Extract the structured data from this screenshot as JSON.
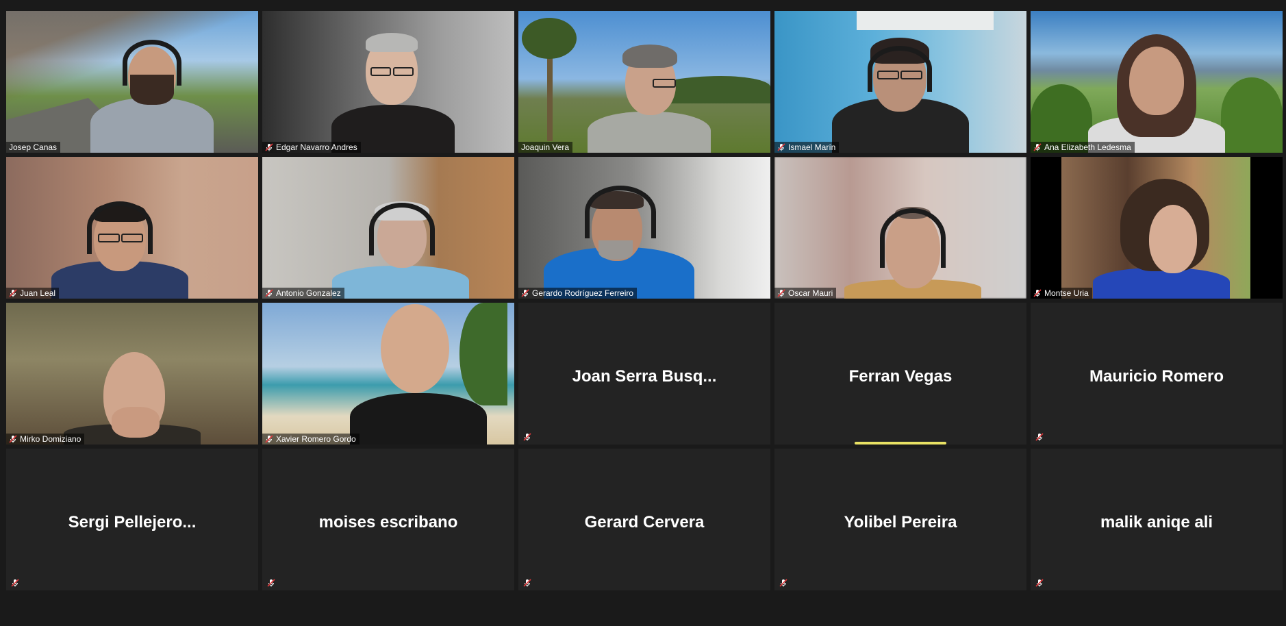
{
  "meeting": {
    "participants": [
      {
        "name": "Josep Canas",
        "video": true,
        "muted": false
      },
      {
        "name": "Edgar Navarro Andres",
        "video": true,
        "muted": true
      },
      {
        "name": "Joaquin Vera",
        "video": true,
        "muted": false,
        "active_speaker": true
      },
      {
        "name": "Ismael Marín",
        "video": true,
        "muted": true
      },
      {
        "name": "Ana Elizabeth Ledesma",
        "video": true,
        "muted": true
      },
      {
        "name": "Juan Leal",
        "video": true,
        "muted": true
      },
      {
        "name": "Antonio Gonzalez",
        "video": true,
        "muted": true
      },
      {
        "name": "Gerardo Rodríguez Ferreiro",
        "video": true,
        "muted": true
      },
      {
        "name": "Oscar Mauri",
        "video": true,
        "muted": true
      },
      {
        "name": "Montse Uria",
        "video": true,
        "muted": true
      },
      {
        "name": "Mirko Domiziano",
        "video": true,
        "muted": true
      },
      {
        "name": "Xavier Romero Gordo",
        "video": true,
        "muted": true
      },
      {
        "name": "Joan  Serra  Busq...",
        "video": false,
        "muted": true
      },
      {
        "name": "Ferran Vegas",
        "video": false,
        "muted": false,
        "speaking": true
      },
      {
        "name": "Mauricio Romero",
        "video": false,
        "muted": true
      },
      {
        "name": "Sergi  Pellejero...",
        "video": false,
        "muted": true
      },
      {
        "name": "moises escribano",
        "video": false,
        "muted": true
      },
      {
        "name": "Gerard Cervera",
        "video": false,
        "muted": true
      },
      {
        "name": "Yolibel Pereira",
        "video": false,
        "muted": true
      },
      {
        "name": "malik aniqe ali",
        "video": false,
        "muted": true
      }
    ],
    "colors": {
      "background": "#1a1a1a",
      "tile_background": "#232323",
      "active_speaker_border": "#c9d96a",
      "speaking_indicator": "#e9e264",
      "muted_icon": "#e0383b"
    },
    "icons": {
      "muted": "microphone-muted-icon"
    }
  }
}
